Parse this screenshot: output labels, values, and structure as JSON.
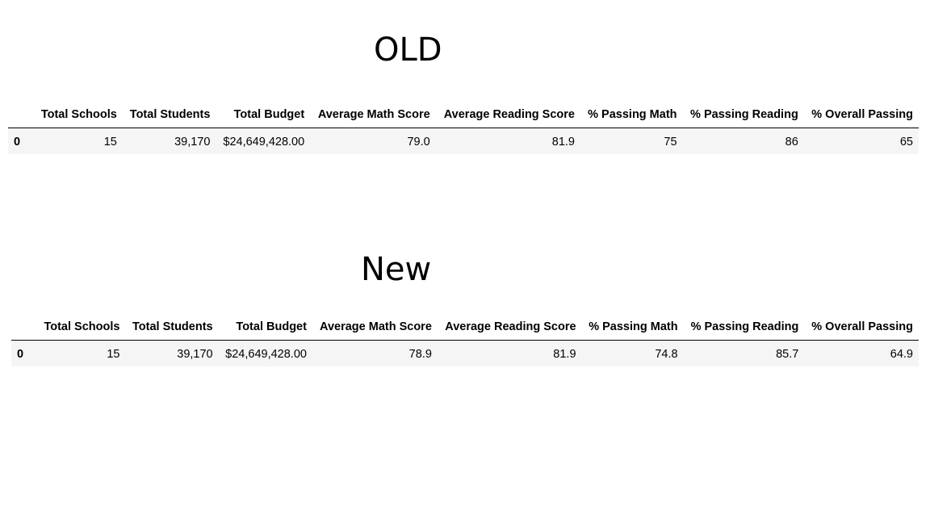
{
  "old": {
    "title": "OLD",
    "columns": [
      "Total Schools",
      "Total Students",
      "Total Budget",
      "Average Math Score",
      "Average Reading Score",
      "% Passing Math",
      "% Passing Reading",
      "% Overall Passing"
    ],
    "rows": [
      {
        "index": "0",
        "cells": [
          "15",
          "39,170",
          "$24,649,428.00",
          "79.0",
          "81.9",
          "75",
          "86",
          "65"
        ]
      }
    ]
  },
  "new": {
    "title": "New",
    "columns": [
      "Total Schools",
      "Total Students",
      "Total Budget",
      "Average Math Score",
      "Average Reading Score",
      "% Passing Math",
      "% Passing Reading",
      "% Overall Passing"
    ],
    "rows": [
      {
        "index": "0",
        "cells": [
          "15",
          "39,170",
          "$24,649,428.00",
          "78.9",
          "81.9",
          "74.8",
          "85.7",
          "64.9"
        ]
      }
    ]
  }
}
